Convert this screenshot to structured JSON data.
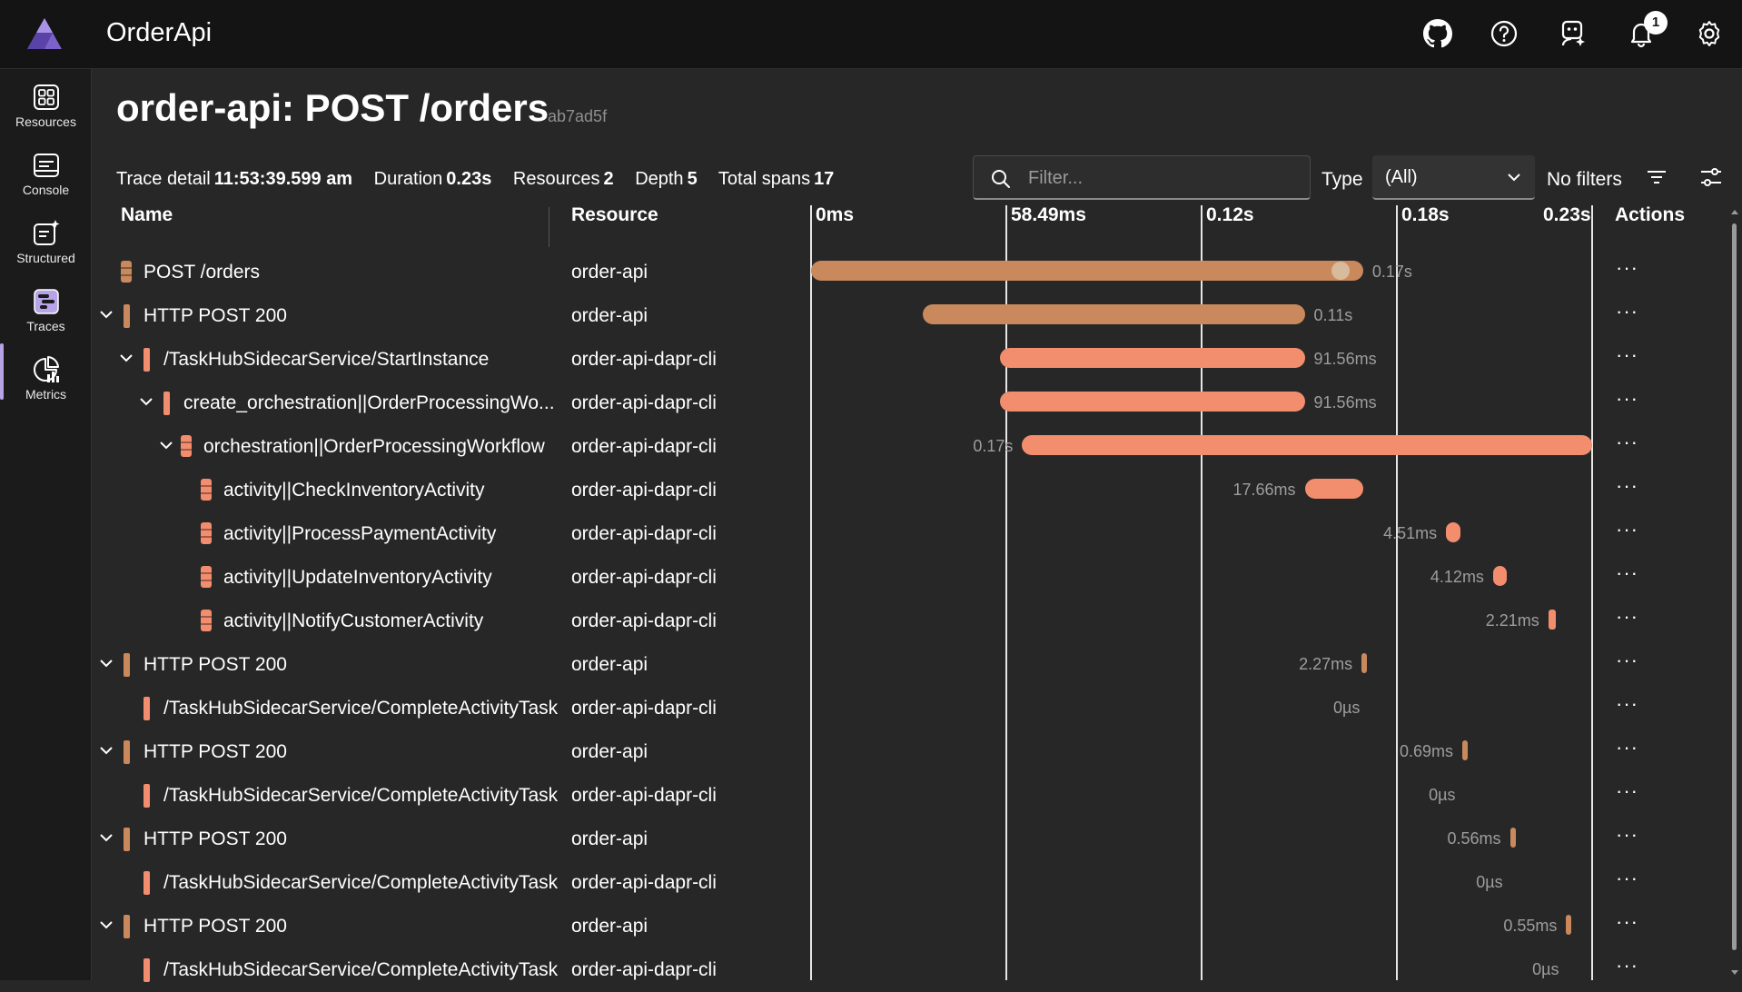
{
  "app": {
    "title": "OrderApi",
    "notification_count": "1"
  },
  "nav": [
    {
      "label": "Resources",
      "icon": "resources-icon"
    },
    {
      "label": "Console",
      "icon": "console-icon"
    },
    {
      "label": "Structured",
      "icon": "structured-icon"
    },
    {
      "label": "Traces",
      "icon": "traces-icon"
    },
    {
      "label": "Metrics",
      "icon": "metrics-icon"
    }
  ],
  "page": {
    "title": "order-api: POST /orders",
    "trace_id": "ab7ad5f"
  },
  "summary": {
    "trace_detail_label": "Trace detail",
    "trace_detail_value": "11:53:39.599 am",
    "duration_label": "Duration",
    "duration_value": "0.23s",
    "resources_label": "Resources",
    "resources_value": "2",
    "depth_label": "Depth",
    "depth_value": "5",
    "total_spans_label": "Total spans",
    "total_spans_value": "17"
  },
  "filter": {
    "placeholder": "Filter...",
    "type_label": "Type",
    "type_value": "(All)",
    "no_filters": "No filters"
  },
  "columns": {
    "name": "Name",
    "resource": "Resource",
    "actions": "Actions"
  },
  "timeline_ticks": [
    "0ms",
    "58.49ms",
    "0.12s",
    "0.18s",
    "0.23s"
  ],
  "colors": {
    "order_api": "#c9895d",
    "dapr_cli": "#f28d6e",
    "accent": "#b7a3e8"
  },
  "spans": [
    {
      "name": "POST /orders",
      "resource": "order-api",
      "duration": "0.17s",
      "start": 0.0,
      "end": 0.17,
      "depth": 0,
      "expand": false,
      "kind": "db",
      "res": "order_api",
      "label_side": "right"
    },
    {
      "name": "HTTP POST 200",
      "resource": "order-api",
      "duration": "0.11s",
      "start": 0.0343,
      "end": 0.152,
      "depth": 0,
      "expand": true,
      "kind": "bar",
      "res": "order_api",
      "label_side": "right"
    },
    {
      "name": "/TaskHubSidecarService/StartInstance",
      "resource": "order-api-dapr-cli",
      "duration": "91.56ms",
      "start": 0.0583,
      "end": 0.152,
      "depth": 1,
      "expand": true,
      "kind": "bar",
      "res": "dapr_cli",
      "label_side": "right"
    },
    {
      "name": "create_orchestration||OrderProcessingWo...",
      "resource": "order-api-dapr-cli",
      "duration": "91.56ms",
      "start": 0.0583,
      "end": 0.152,
      "depth": 2,
      "expand": true,
      "kind": "bar",
      "res": "dapr_cli",
      "label_side": "right"
    },
    {
      "name": "orchestration||OrderProcessingWorkflow",
      "resource": "order-api-dapr-cli",
      "duration": "0.17s",
      "start": 0.065,
      "end": 0.2405,
      "depth": 3,
      "expand": true,
      "kind": "db",
      "res": "dapr_cli",
      "label_side": "left"
    },
    {
      "name": "activity||CheckInventoryActivity",
      "resource": "order-api-dapr-cli",
      "duration": "17.66ms",
      "start": 0.152,
      "end": 0.17,
      "depth": 4,
      "expand": false,
      "kind": "db",
      "res": "dapr_cli",
      "label_side": "left"
    },
    {
      "name": "activity||ProcessPaymentActivity",
      "resource": "order-api-dapr-cli",
      "duration": "4.51ms",
      "start": 0.1955,
      "end": 0.2,
      "depth": 4,
      "expand": false,
      "kind": "db",
      "res": "dapr_cli",
      "label_side": "left"
    },
    {
      "name": "activity||UpdateInventoryActivity",
      "resource": "order-api-dapr-cli",
      "duration": "4.12ms",
      "start": 0.21,
      "end": 0.2141,
      "depth": 4,
      "expand": false,
      "kind": "db",
      "res": "dapr_cli",
      "label_side": "left"
    },
    {
      "name": "activity||NotifyCustomerActivity",
      "resource": "order-api-dapr-cli",
      "duration": "2.21ms",
      "start": 0.227,
      "end": 0.2292,
      "depth": 4,
      "expand": false,
      "kind": "db",
      "res": "dapr_cli",
      "label_side": "left"
    },
    {
      "name": "HTTP POST 200",
      "resource": "order-api",
      "duration": "2.27ms",
      "start": 0.1695,
      "end": 0.1718,
      "depth": 0,
      "expand": true,
      "kind": "bar",
      "res": "order_api",
      "label_side": "left"
    },
    {
      "name": "/TaskHubSidecarService/CompleteActivityTask",
      "resource": "order-api-dapr-cli",
      "duration": "0µs",
      "start": 0.1718,
      "end": 0.1718,
      "depth": 1,
      "expand": false,
      "kind": "bar",
      "res": "dapr_cli",
      "label_side": "left"
    },
    {
      "name": "HTTP POST 200",
      "resource": "order-api",
      "duration": "0.69ms",
      "start": 0.2005,
      "end": 0.2012,
      "depth": 0,
      "expand": true,
      "kind": "bar",
      "res": "order_api",
      "label_side": "left"
    },
    {
      "name": "/TaskHubSidecarService/CompleteActivityTask",
      "resource": "order-api-dapr-cli",
      "duration": "0µs",
      "start": 0.2012,
      "end": 0.2012,
      "depth": 1,
      "expand": false,
      "kind": "bar",
      "res": "dapr_cli",
      "label_side": "left"
    },
    {
      "name": "HTTP POST 200",
      "resource": "order-api",
      "duration": "0.56ms",
      "start": 0.2152,
      "end": 0.2158,
      "depth": 0,
      "expand": true,
      "kind": "bar",
      "res": "order_api",
      "label_side": "left"
    },
    {
      "name": "/TaskHubSidecarService/CompleteActivityTask",
      "resource": "order-api-dapr-cli",
      "duration": "0µs",
      "start": 0.2158,
      "end": 0.2158,
      "depth": 1,
      "expand": false,
      "kind": "bar",
      "res": "dapr_cli",
      "label_side": "left"
    },
    {
      "name": "HTTP POST 200",
      "resource": "order-api",
      "duration": "0.55ms",
      "start": 0.2325,
      "end": 0.2331,
      "depth": 0,
      "expand": true,
      "kind": "bar",
      "res": "order_api",
      "label_side": "left"
    },
    {
      "name": "/TaskHubSidecarService/CompleteActivityTask",
      "resource": "order-api-dapr-cli",
      "duration": "0µs",
      "start": 0.2331,
      "end": 0.2331,
      "depth": 1,
      "expand": false,
      "kind": "bar",
      "res": "dapr_cli",
      "label_side": "left"
    }
  ]
}
